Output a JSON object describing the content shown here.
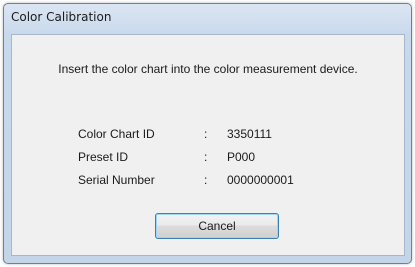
{
  "window": {
    "title": "Color Calibration"
  },
  "dialog": {
    "message": "Insert the color chart into the color measurement device.",
    "fields": [
      {
        "label": "Color Chart ID",
        "separator": ":",
        "value": "3350111"
      },
      {
        "label": "Preset ID",
        "separator": ":",
        "value": "P000"
      },
      {
        "label": "Serial Number",
        "separator": ":",
        "value": "0000000001"
      }
    ],
    "cancel_label": "Cancel"
  }
}
